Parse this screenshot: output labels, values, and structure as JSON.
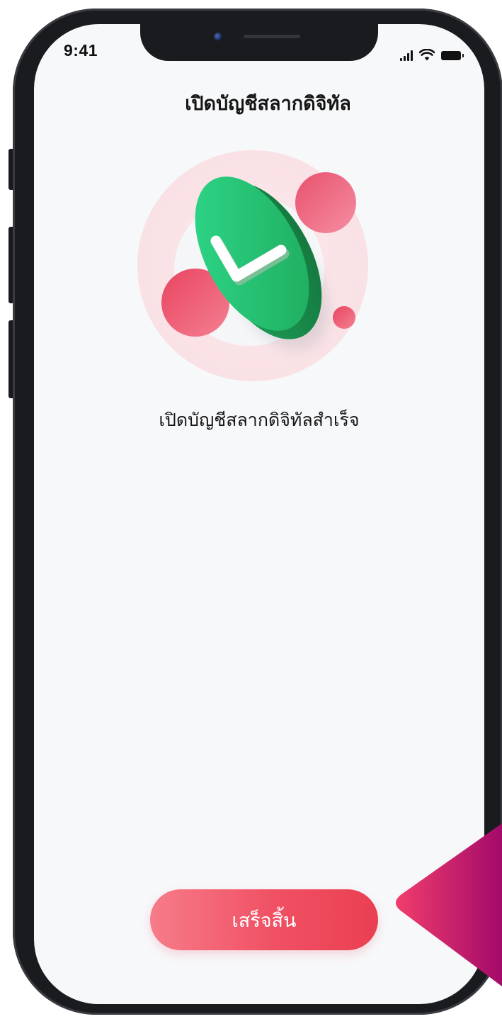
{
  "status_bar": {
    "time": "9:41",
    "icons": [
      "cellular-signal-icon",
      "wifi-icon",
      "battery-icon"
    ]
  },
  "header": {
    "title": "เปิดบัญชีสลากดิจิทัล"
  },
  "main": {
    "illustration_icon": "success-checkmark-icon",
    "message": "เปิดบัญชีสลากดิจิทัลสำเร็จ"
  },
  "footer": {
    "finish_label": "เสร็จสิ้น"
  },
  "colors": {
    "accent": "#ea3f52",
    "accent_light": "#f67c8a",
    "success": "#22b566",
    "pointer": "#e0287a",
    "screen_background": "#f7f8fa"
  }
}
